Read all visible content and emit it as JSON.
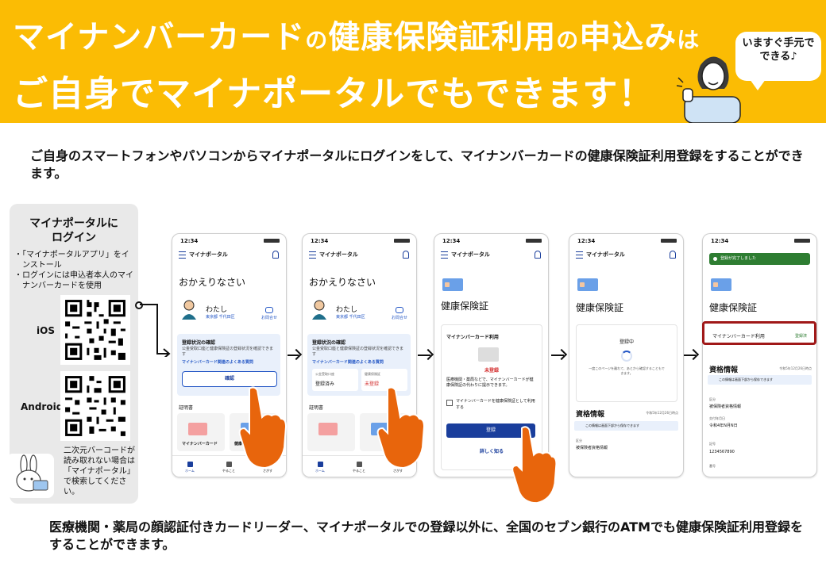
{
  "banner": {
    "line1_a": "マイナンバーカード",
    "line1_b": "の",
    "line1_c": "健康保険証利用",
    "line1_d": "の",
    "line1_e": "申込み",
    "line1_f": "は",
    "line2": "ご自身でマイナポータルでもできます！",
    "bubble_line1": "いますぐ手元で",
    "bubble_line2": "できる♪"
  },
  "intro": "ご自身のスマートフォンやパソコンからマイナポータルにログインをして、マイナンバーカードの健康保険証利用登録をすることができます。",
  "left_panel": {
    "title_line1": "マイナポータルに",
    "title_line2": "ログイン",
    "notes": [
      "・「マイナポータルアプリ」をインストール",
      "・ログインには申込者本人のマイナンバーカードを使用"
    ],
    "ios_label": "iOS",
    "android_label": "Android",
    "footer_note": "二次元バーコードが読み取れない場合は「マイナポータル」で検索してください。"
  },
  "phone1": {
    "time": "12:34",
    "app_title": "マイナポータル",
    "welcome": "おかえりなさい",
    "user_name": "わたし",
    "user_address": "東京都 千代田区",
    "card_link": "お問合せ",
    "status_title": "登録状況の確認",
    "status_text": "公金受取口座と健康保険証の登録状況を確認できます",
    "status_link": "マイナンバーカード関連のよくある質問",
    "confirm_button": "確認",
    "cert_label": "証明書",
    "cert1": "マイナンバーカード",
    "cert2": "健康保険証",
    "nav": [
      "ホーム",
      "やること",
      "さがす"
    ]
  },
  "phone2": {
    "time": "12:34",
    "app_title": "マイナポータル",
    "welcome": "おかえりなさい",
    "user_name": "わたし",
    "user_address": "東京都 千代田区",
    "card_link": "お問合せ",
    "status_title": "登録状況の確認",
    "status_text": "公金受取口座と健康保険証の登録状況を確認できます",
    "status_link": "マイナンバーカード関連のよくある質問",
    "cell1_label": "公金受取口座",
    "cell1_value": "登録済み",
    "cell2_label": "健康保険証",
    "cell2_value": "未登録",
    "cert_label": "証明書",
    "nav": [
      "ホーム",
      "やること",
      "さがす"
    ]
  },
  "phone3": {
    "time": "12:34",
    "app_title": "マイナポータル",
    "title": "健康保険証",
    "box_title": "マイナンバーカード利用",
    "status": "未登録",
    "desc": "医療機関・薬局などで、マイナンバーカードが健康保険証の代わりに提示できます。",
    "checkbox": "マイナンバーカードを健康保険証として利用する",
    "register_button": "登録",
    "more_link": "詳しく知る"
  },
  "phone4": {
    "time": "12:34",
    "app_title": "マイナポータル",
    "title": "健康保険証",
    "registering": "登録中",
    "wait_text": "一度このページを離れて、あとから確認することもできます。",
    "section": "資格情報",
    "section_date": "令和5年12月26日時点",
    "note": "この情報は画面下部から保存できます",
    "field1_label": "区分",
    "field1_value": "被保険者資格情報"
  },
  "phone5": {
    "time": "12:34",
    "done_banner": "登録が完了しました",
    "title": "健康保険証",
    "row_label": "マイナンバーカード利用",
    "row_status": "登録済",
    "section": "資格情報",
    "section_date": "令和5年12月26日時点",
    "note": "この情報は画面下部から保存できます",
    "field1_label": "区分",
    "field1_value": "被保険者資格情報",
    "field2_label": "交付年月日",
    "field2_value": "令和4年N月N日",
    "field3_label": "記号",
    "field3_value": "1234567890",
    "field4_label": "番号"
  },
  "footer": "医療機関・薬局の顔認証付きカードリーダー、マイナポータルでの登録以外に、全国のセブン銀行のATMでも健康保険証利用登録をすることができます。",
  "colors": {
    "banner": "#fbbc04",
    "accent_blue": "#1a3e9c",
    "red": "#d32f2f",
    "highlight": "#a01818",
    "hand": "#e8650c"
  }
}
